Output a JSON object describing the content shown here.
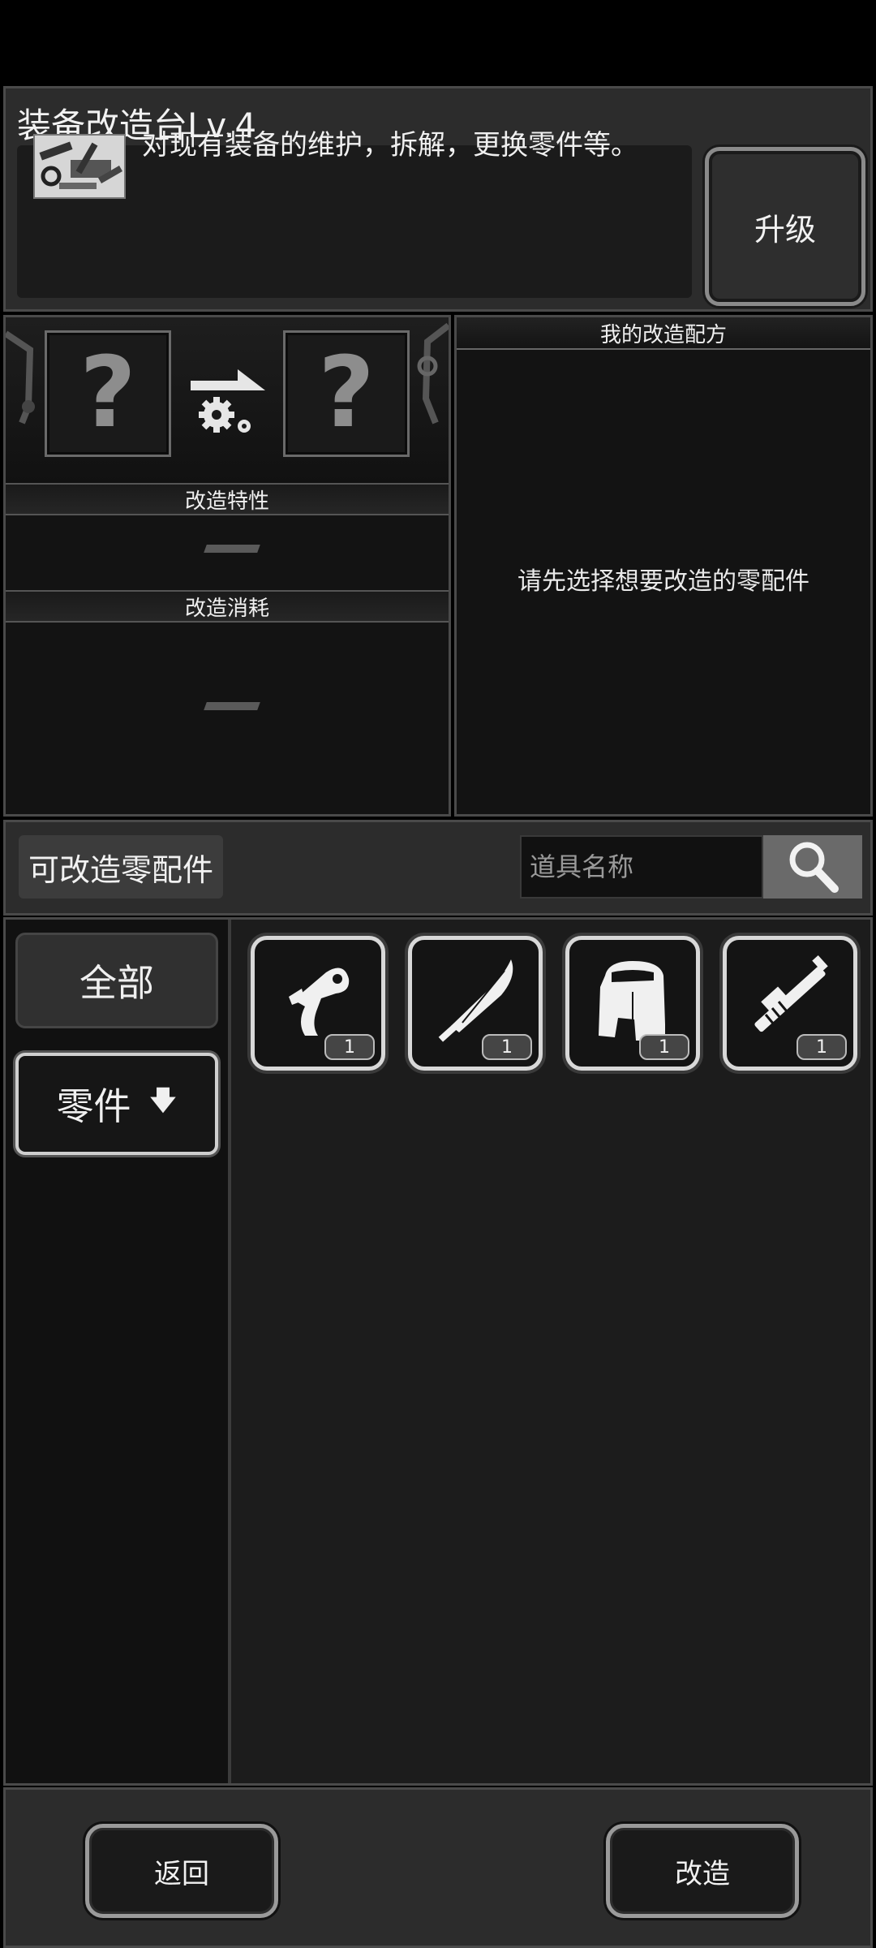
{
  "header": {
    "title": "装备改造台Lv.4",
    "description": "对现有装备的维护，拆解，更换零件等。",
    "upgrade_label": "升级"
  },
  "modify": {
    "source_slot": "?",
    "target_slot": "?",
    "traits_label": "改造特性",
    "traits_value": "—",
    "cost_label": "改造消耗",
    "cost_value": "—"
  },
  "recipe": {
    "title": "我的改造配方",
    "empty_hint": "请先选择想要改造的零配件"
  },
  "parts": {
    "title": "可改造零配件",
    "search_placeholder": "道具名称",
    "categories": [
      {
        "label": "全部"
      },
      {
        "label": "零件",
        "arrow": "🡇"
      }
    ],
    "items": [
      {
        "icon": "trigger-icon",
        "count": "1"
      },
      {
        "icon": "blade-icon",
        "count": "1"
      },
      {
        "icon": "stock-icon",
        "count": "1"
      },
      {
        "icon": "barrel-icon",
        "count": "1"
      }
    ]
  },
  "footer": {
    "back_label": "返回",
    "modify_label": "改造"
  }
}
